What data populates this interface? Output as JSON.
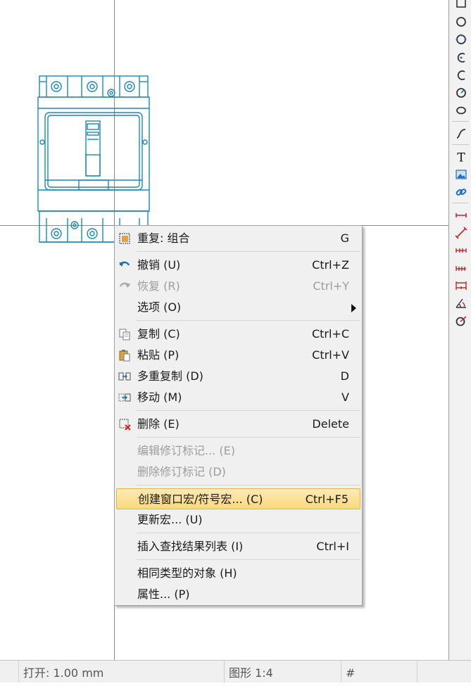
{
  "menu": {
    "items": [
      {
        "label": "重复: 组合",
        "shortcut": "G",
        "icon": "repeat-group-icon"
      },
      {
        "label": "撤销 (U)",
        "shortcut": "Ctrl+Z",
        "icon": "undo-icon"
      },
      {
        "label": "恢复 (R)",
        "shortcut": "Ctrl+Y",
        "icon": "redo-icon",
        "disabled": true
      },
      {
        "label": "选项 (O)",
        "shortcut": "",
        "submenu": true
      },
      {
        "label": "复制 (C)",
        "shortcut": "Ctrl+C",
        "icon": "copy-icon"
      },
      {
        "label": "粘贴 (P)",
        "shortcut": "Ctrl+V",
        "icon": "paste-icon"
      },
      {
        "label": "多重复制 (D)",
        "shortcut": "D",
        "icon": "multi-copy-icon"
      },
      {
        "label": "移动 (M)",
        "shortcut": "V",
        "icon": "move-icon"
      },
      {
        "label": "删除 (E)",
        "shortcut": "Delete",
        "icon": "delete-icon"
      },
      {
        "label": "编辑修订标记... (E)",
        "shortcut": "",
        "disabled": true
      },
      {
        "label": "删除修订标记 (D)",
        "shortcut": "",
        "disabled": true
      },
      {
        "label": "创建窗口宏/符号宏... (C)",
        "shortcut": "Ctrl+F5",
        "highlighted": true
      },
      {
        "label": "更新宏... (U)",
        "shortcut": ""
      },
      {
        "label": "插入查找结果列表 (I)",
        "shortcut": "Ctrl+I"
      },
      {
        "label": "相同类型的对象 (H)",
        "shortcut": ""
      },
      {
        "label": "属性... (P)",
        "shortcut": ""
      }
    ]
  },
  "statusbar": {
    "snap": "打开: 1.00 mm",
    "scale": "图形 1:4",
    "grid": "#"
  },
  "toolbar": {
    "tools": [
      "rectangle-icon",
      "circle-icon",
      "circle-3pt-icon",
      "arc-icon",
      "arc-3pt-icon",
      "circle-arc-icon",
      "ellipse-icon",
      "spline-icon",
      "text-icon",
      "image-icon",
      "link-icon",
      "dimension-linear-icon",
      "dimension-aligned-icon",
      "dimension-chain-icon",
      "dimension-incremental-icon",
      "dimension-baseline-icon",
      "dimension-angle-icon",
      "dimension-radius-icon"
    ],
    "text_tool_glyph": "T"
  },
  "colors": {
    "drawing": "#1e86b4",
    "menu_bg": "#f0f0f0",
    "highlight": "#fbd97f",
    "dimension": "#c0282c",
    "icon_blue": "#1f6fb6"
  }
}
